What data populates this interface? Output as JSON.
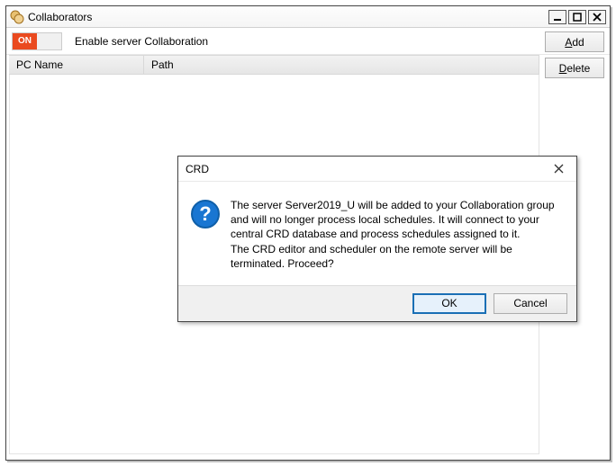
{
  "window": {
    "title": "Collaborators"
  },
  "toolbar": {
    "toggle_state": "ON",
    "toggle_label": "Enable server Collaboration",
    "add_label": "Add",
    "delete_label": "Delete"
  },
  "columns": {
    "pc": "PC Name",
    "path": "Path"
  },
  "dialog": {
    "title": "CRD",
    "message": "The server Server2019_U will be added to your Collaboration group and will no longer process local schedules. It will connect to your central CRD database and process schedules assigned to it.\nThe CRD editor and scheduler on the remote server will be terminated. Proceed?",
    "ok_label": "OK",
    "cancel_label": "Cancel"
  }
}
